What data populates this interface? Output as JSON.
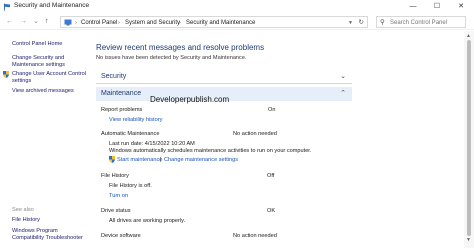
{
  "window": {
    "title": "Security and Maintenance",
    "controls": {
      "minimize": "—",
      "maximize": "☐",
      "close": "✕"
    }
  },
  "nav": {
    "back": "←",
    "forward": "→",
    "recent": "⌄",
    "up": "↑",
    "breadcrumbs": [
      "Control Panel",
      "System and Security",
      "Security and Maintenance"
    ],
    "separator": "›",
    "search_placeholder": "Search Control Panel"
  },
  "sidebar": {
    "links": [
      "Control Panel Home",
      "Change Security and",
      "Maintenance settings",
      "Change User Account Control",
      "settings",
      "View archived messages"
    ],
    "see_also": "See also",
    "see_also_links": [
      "File History",
      "Windows Program",
      "Compatibility Troubleshooter"
    ]
  },
  "main": {
    "heading": "Review recent messages and resolve problems",
    "subtext": "No issues have been detected by Security and Maintenance.",
    "security_title": "Security",
    "maintenance_title": "Maintenance",
    "watermark": "Developerpublish.com",
    "items": {
      "report_problems": {
        "label": "Report problems",
        "status": "On",
        "link": "View reliability history"
      },
      "auto_maintenance": {
        "label": "Automatic Maintenance",
        "status": "No action needed",
        "last_run": "Last run date: 4/15/2022 10:20 AM",
        "desc": "Windows automatically schedules maintenance activities to run on your computer.",
        "link_start": "Start maintenance",
        "link_sep": "|",
        "link_change": "Change maintenance settings"
      },
      "file_history": {
        "label": "File History",
        "status": "Off",
        "desc": "File History is off.",
        "link": "Turn on"
      },
      "drive_status": {
        "label": "Drive status",
        "status": "OK",
        "desc": "All drives are working properly."
      },
      "device_software": {
        "label": "Device software",
        "status": "No action needed"
      }
    }
  },
  "colors": {
    "accent": "#1f3a73",
    "link": "#1a52b8",
    "section_open_bg": "#e6eef9"
  }
}
